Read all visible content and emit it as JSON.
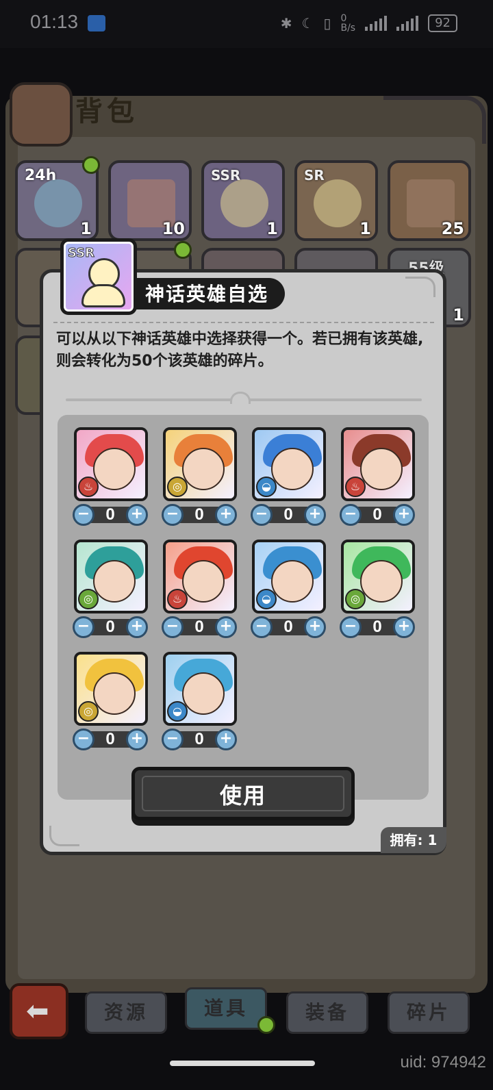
{
  "status_bar": {
    "time": "01:13",
    "network_rate": "0\nB/s",
    "battery": "92"
  },
  "bag": {
    "title": "背包",
    "items_row1": [
      {
        "label": "24h",
        "count": "1",
        "color": "#b9a8e0"
      },
      {
        "label": "",
        "count": "10",
        "color": "#c8a6e6"
      },
      {
        "label": "SSR",
        "count": "1",
        "color": "#c2a0e8"
      },
      {
        "label": "SR",
        "count": "1",
        "color": "#e8b46a"
      },
      {
        "label": "",
        "count": "25",
        "color": "#e8a45a"
      }
    ],
    "items_row2_partial": [
      {
        "label": "55级",
        "count": "1"
      }
    ]
  },
  "modal": {
    "item_badge": "SSR",
    "title": "神话英雄自选",
    "description": "可以从以下神话英雄中选择获得一个。若已拥有该英雄,则会转化为50个该英雄的碎片。",
    "heroes": [
      {
        "element": "fire",
        "element_glyph": "♨",
        "bg": "#f2a7c6",
        "hair": "#e34b4b",
        "qty": "0"
      },
      {
        "element": "earth",
        "element_glyph": "◎",
        "bg": "#f5d27a",
        "hair": "#e8803a",
        "qty": "0"
      },
      {
        "element": "water",
        "element_glyph": "◒",
        "bg": "#9ec9f2",
        "hair": "#3b7fd6",
        "qty": "0"
      },
      {
        "element": "fire",
        "element_glyph": "♨",
        "bg": "#e88e8e",
        "hair": "#8b3a2a",
        "qty": "0"
      },
      {
        "element": "wind",
        "element_glyph": "◎",
        "bg": "#b6e6d0",
        "hair": "#2e9f9a",
        "qty": "0"
      },
      {
        "element": "fire",
        "element_glyph": "♨",
        "bg": "#f5a08a",
        "hair": "#e0462f",
        "qty": "0"
      },
      {
        "element": "water",
        "element_glyph": "◒",
        "bg": "#a8d2f5",
        "hair": "#3a8fd0",
        "qty": "0"
      },
      {
        "element": "wind",
        "element_glyph": "◎",
        "bg": "#a8e6a2",
        "hair": "#3fb85b",
        "qty": "0"
      },
      {
        "element": "earth",
        "element_glyph": "◎",
        "bg": "#fbe08a",
        "hair": "#f1c23e",
        "qty": "0"
      },
      {
        "element": "water",
        "element_glyph": "◒",
        "bg": "#9ed0ef",
        "hair": "#46a8d8",
        "qty": "0"
      }
    ],
    "stepper_minus": "−",
    "stepper_plus": "+",
    "use_button": "使用",
    "owned_label": "拥有: 1"
  },
  "nav": {
    "tabs": [
      "资源",
      "道具",
      "装备",
      "碎片"
    ],
    "active": "道具",
    "back_icon": "⬅"
  },
  "uid": "uid: 974942"
}
